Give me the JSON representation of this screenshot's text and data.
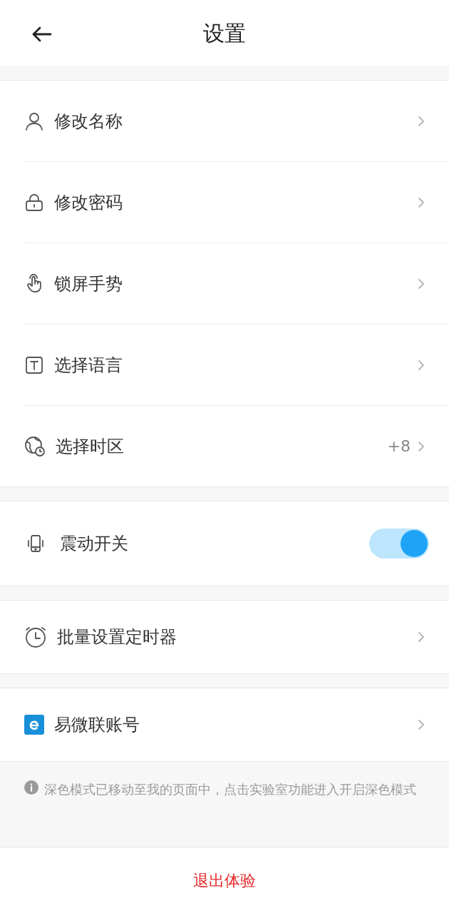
{
  "header": {
    "title": "设置"
  },
  "groups": [
    {
      "items": [
        {
          "kind": "link",
          "label": "修改名称"
        },
        {
          "kind": "link",
          "label": "修改密码"
        },
        {
          "kind": "link",
          "label": "锁屏手势"
        },
        {
          "kind": "link",
          "label": "选择语言"
        },
        {
          "kind": "link",
          "label": "选择时区",
          "value": "+8"
        }
      ]
    },
    {
      "items": [
        {
          "kind": "toggle",
          "label": "震动开关",
          "on": true
        }
      ]
    },
    {
      "items": [
        {
          "kind": "link",
          "label": "批量设置定时器"
        }
      ]
    },
    {
      "items": [
        {
          "kind": "link",
          "label": "易微联账号"
        }
      ]
    }
  ],
  "note": "深色模式已移动至我的页面中，点击实验室功能进入开启深色模式",
  "logout": "退出体验"
}
